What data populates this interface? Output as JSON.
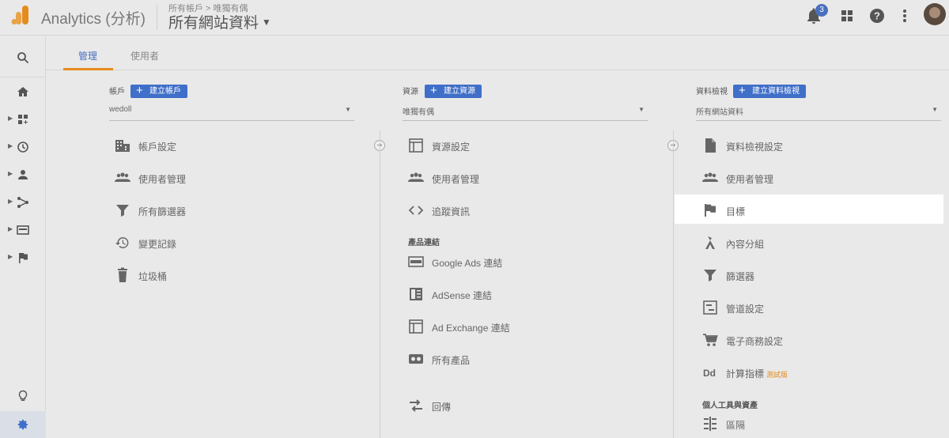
{
  "app": {
    "brand": "Analytics (分析)",
    "breadcrumb": "所有帳戶 > 唯獨有偶",
    "account_view": "所有網站資料",
    "notification_count": "3"
  },
  "tabs": {
    "admin": "管理",
    "users": "使用者"
  },
  "account": {
    "heading": "帳戶",
    "create_button": "建立帳戶",
    "selected": "wedoll",
    "items": [
      "帳戶設定",
      "使用者管理",
      "所有篩選器",
      "變更記錄",
      "垃圾桶"
    ]
  },
  "property": {
    "heading": "資源",
    "create_button": "建立資源",
    "selected": "唯獨有偶",
    "items": [
      "資源設定",
      "使用者管理",
      "追蹤資訊"
    ],
    "section_product": "產品連結",
    "products": [
      "Google Ads 連結",
      "AdSense 連結",
      "Ad Exchange 連結",
      "所有產品"
    ],
    "extra": "回傳"
  },
  "view": {
    "heading": "資料檢視",
    "create_button": "建立資料檢視",
    "selected": "所有網站資料",
    "items": [
      "資料檢視設定",
      "使用者管理",
      "目標",
      "內容分組",
      "篩選器",
      "管道設定",
      "電子商務設定",
      "計算指標"
    ],
    "beta": "測試版",
    "section_personal": "個人工具與資產",
    "personal": [
      "區隔"
    ]
  },
  "colors": {
    "accent": "#3f6fc8",
    "tab_underline": "#e58b1e",
    "logo_orange": "#e58b1e"
  }
}
